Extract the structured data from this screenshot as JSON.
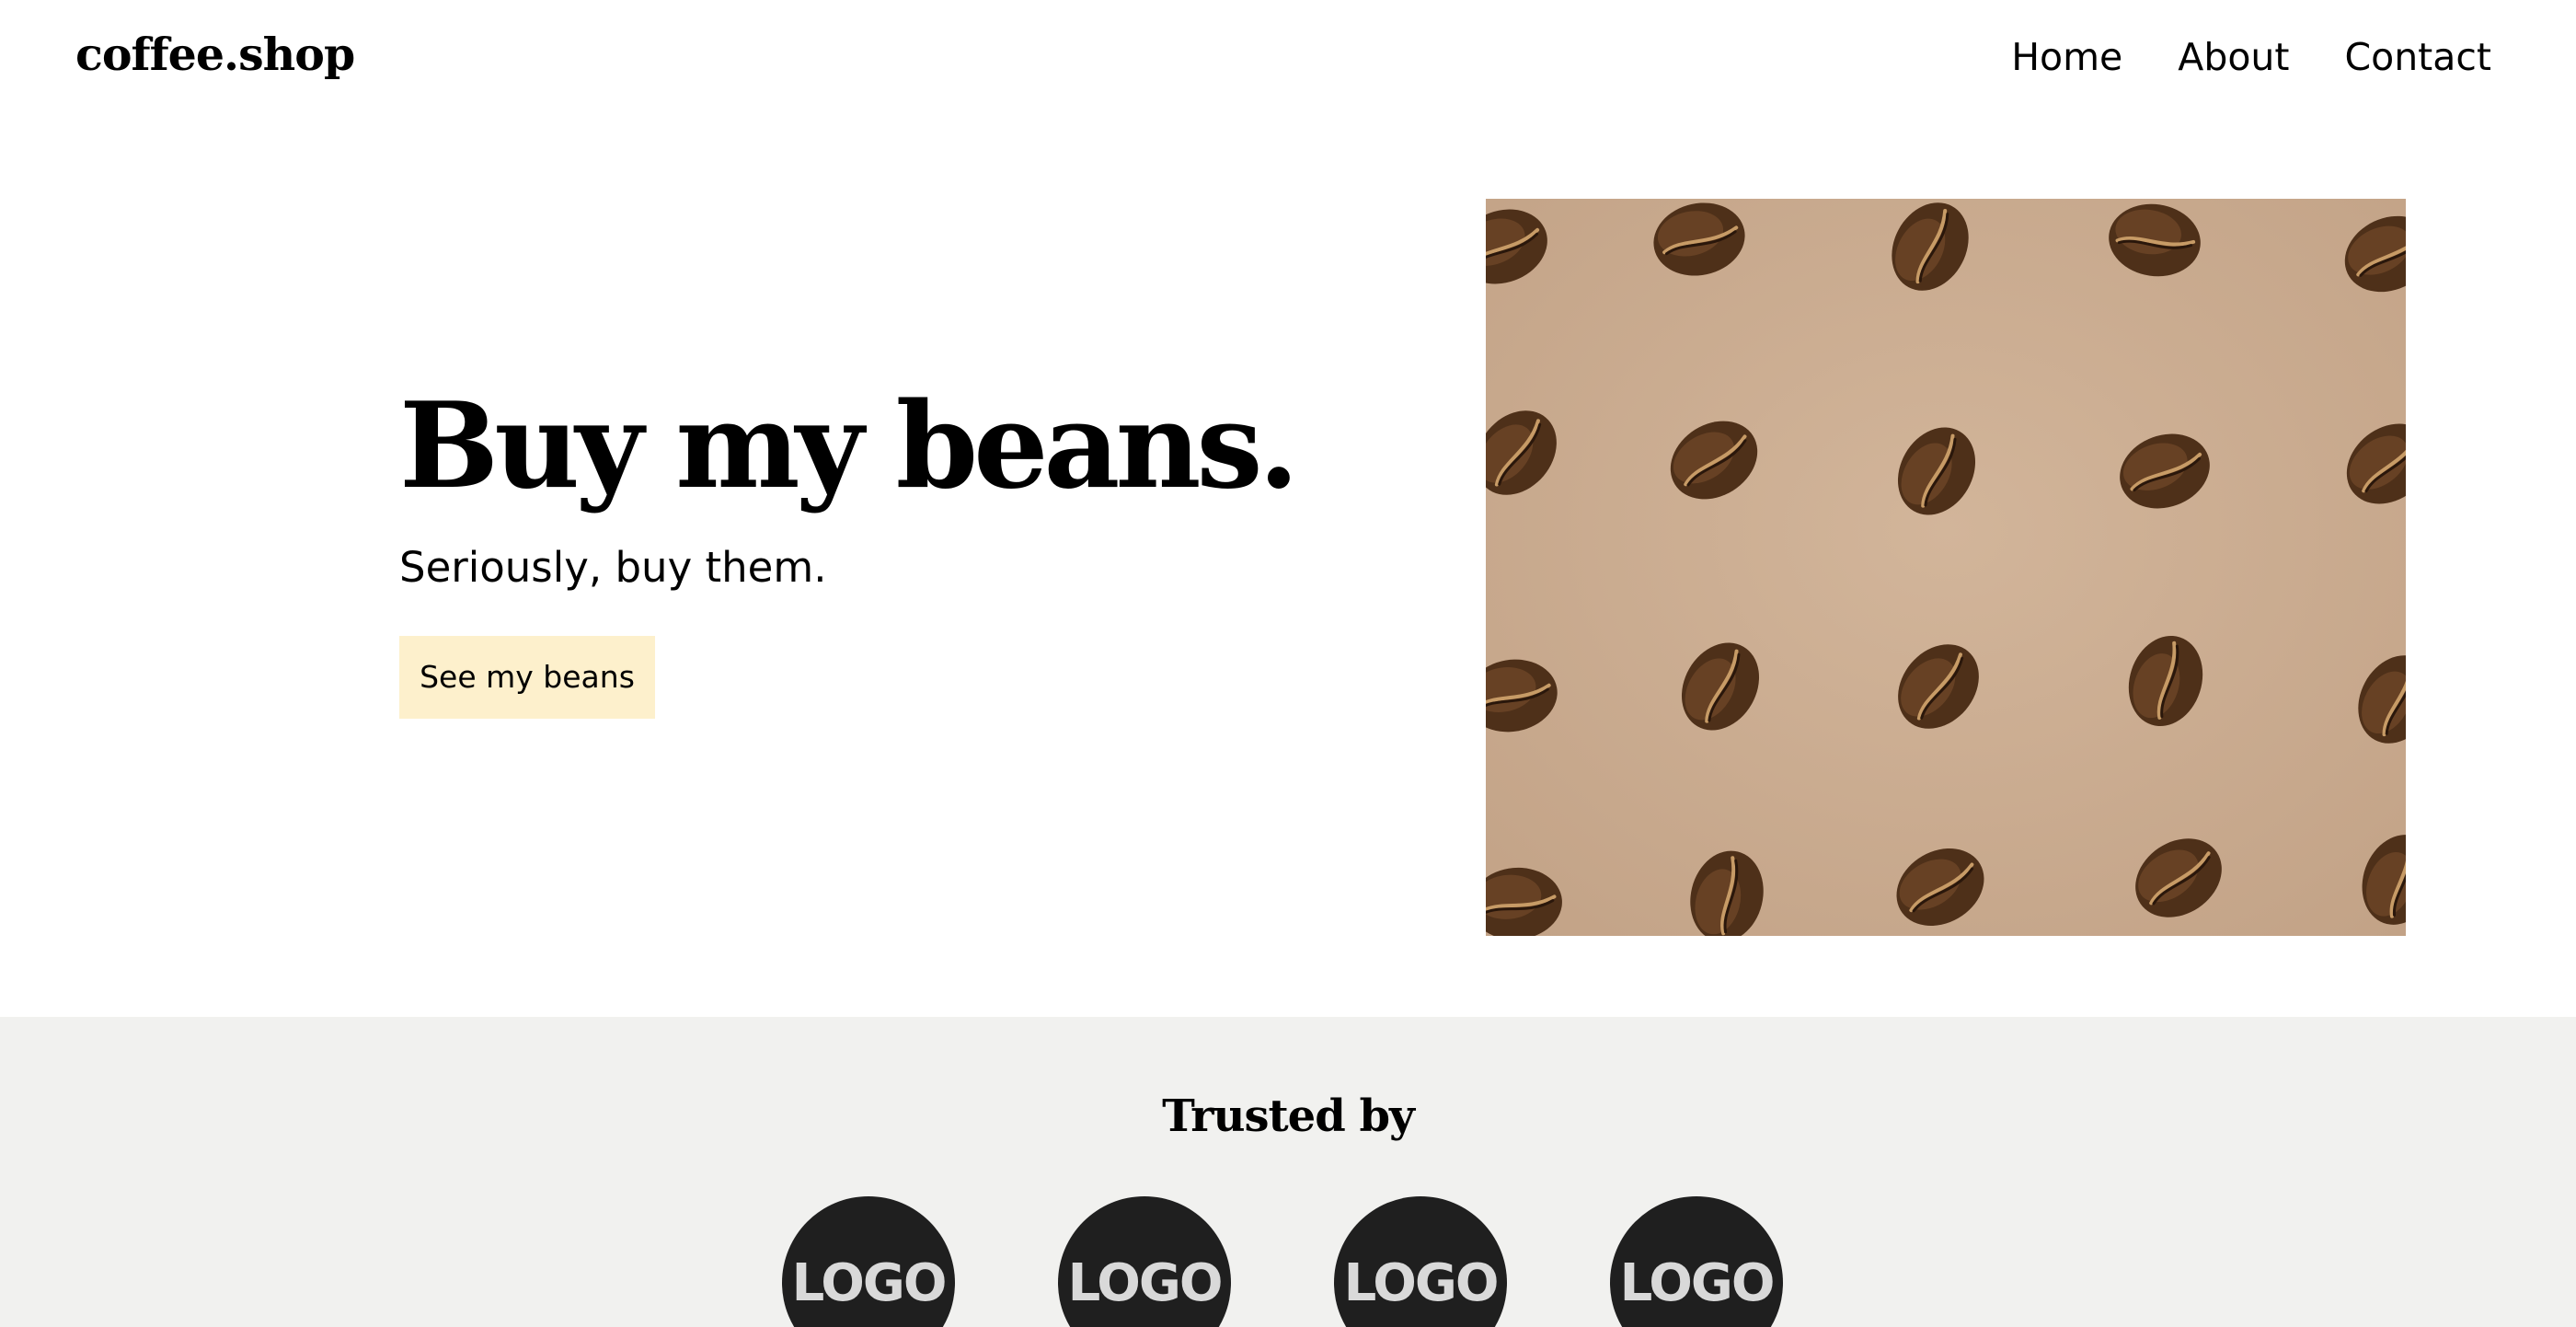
{
  "header": {
    "brand": "coffee.shop",
    "nav": [
      "Home",
      "About",
      "Contact"
    ]
  },
  "hero": {
    "title": "Buy my beans.",
    "subtitle": "Seriously, buy them.",
    "cta_label": "See my beans",
    "image_alt": "coffee beans on kraft paper"
  },
  "trusted": {
    "title": "Trusted by",
    "logos": [
      "LOGO",
      "LOGO",
      "LOGO",
      "LOGO"
    ]
  },
  "colors": {
    "cta_background": "#fdf0cc",
    "trusted_background": "#f1f1ef",
    "logo_circle": "#1f1f1f",
    "image_paper": "#c8a98d",
    "bean": "#5a3820"
  }
}
